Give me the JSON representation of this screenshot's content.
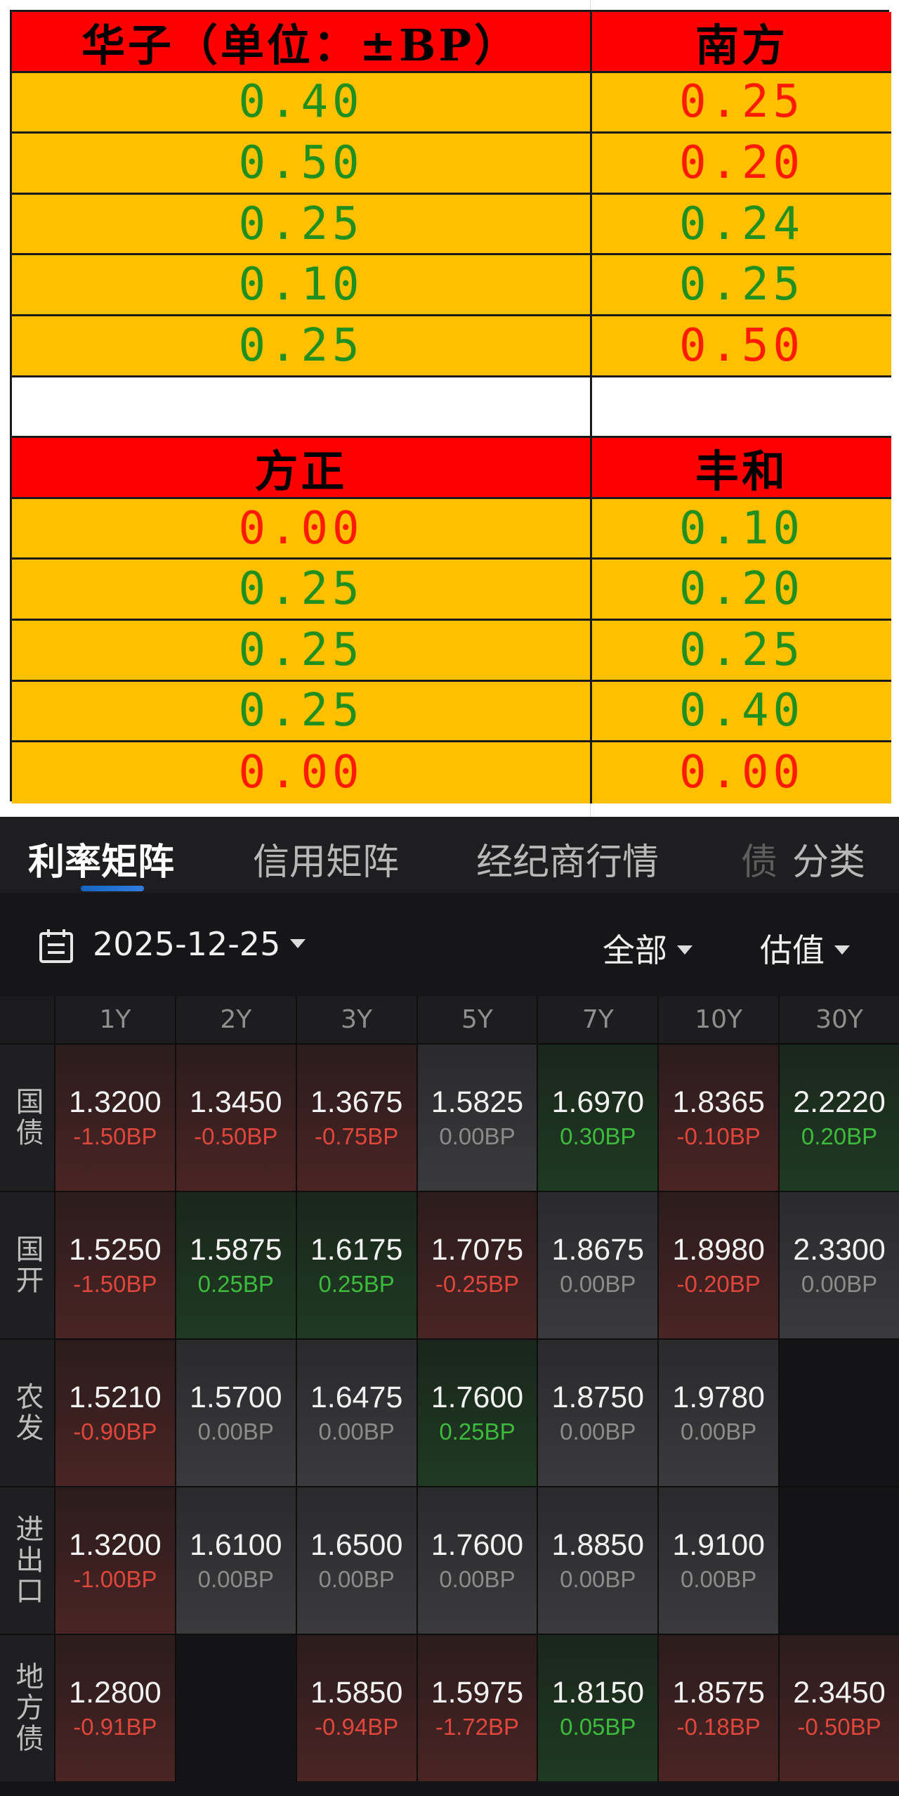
{
  "sheet": {
    "block1": {
      "headers": [
        "华子（单位：±BP）",
        "南方"
      ],
      "rows": [
        {
          "left": "0.40",
          "left_color": "green",
          "right": "0.25",
          "right_color": "red"
        },
        {
          "left": "0.50",
          "left_color": "green",
          "right": "0.20",
          "right_color": "red"
        },
        {
          "left": "0.25",
          "left_color": "green",
          "right": "0.24",
          "right_color": "green"
        },
        {
          "left": "0.10",
          "left_color": "green",
          "right": "0.25",
          "right_color": "green"
        },
        {
          "left": "0.25",
          "left_color": "green",
          "right": "0.50",
          "right_color": "red"
        }
      ]
    },
    "block2": {
      "headers": [
        "方正",
        "丰和"
      ],
      "rows": [
        {
          "left": "0.00",
          "left_color": "red",
          "right": "0.10",
          "right_color": "green"
        },
        {
          "left": "0.25",
          "left_color": "green",
          "right": "0.20",
          "right_color": "green"
        },
        {
          "left": "0.25",
          "left_color": "green",
          "right": "0.25",
          "right_color": "green"
        },
        {
          "left": "0.25",
          "left_color": "green",
          "right": "0.40",
          "right_color": "green"
        },
        {
          "left": "0.00",
          "left_color": "red",
          "right": "0.00",
          "right_color": "red"
        }
      ]
    },
    "colors": {
      "header_bg": "#ff0000",
      "cell_bg": "#ffc000",
      "green_text": "#1f8f1f",
      "red_text": "#ff1a00"
    }
  },
  "tabs": [
    {
      "label": "利率矩阵",
      "active": true
    },
    {
      "label": "信用矩阵",
      "active": false
    },
    {
      "label": "经纪商行情",
      "active": false
    },
    {
      "label": "债",
      "active": false
    },
    {
      "label": "分类",
      "active": false
    }
  ],
  "filters": {
    "date": "2025-12-25",
    "scope": "全部",
    "mode": "估值",
    "calendar_icon": "calendar-icon"
  },
  "matrix": {
    "columns": [
      "1Y",
      "2Y",
      "3Y",
      "5Y",
      "7Y",
      "10Y",
      "30Y"
    ],
    "rows": [
      {
        "label": "国债",
        "cells": [
          {
            "rate": "1.3200",
            "chg": "-1.50BP",
            "dir": "red"
          },
          {
            "rate": "1.3450",
            "chg": "-0.50BP",
            "dir": "red"
          },
          {
            "rate": "1.3675",
            "chg": "-0.75BP",
            "dir": "red"
          },
          {
            "rate": "1.5825",
            "chg": "0.00BP",
            "dir": "flat"
          },
          {
            "rate": "1.6970",
            "chg": "0.30BP",
            "dir": "green"
          },
          {
            "rate": "1.8365",
            "chg": "-0.10BP",
            "dir": "red"
          },
          {
            "rate": "2.2220",
            "chg": "0.20BP",
            "dir": "green"
          }
        ]
      },
      {
        "label": "国开",
        "cells": [
          {
            "rate": "1.5250",
            "chg": "-1.50BP",
            "dir": "red"
          },
          {
            "rate": "1.5875",
            "chg": "0.25BP",
            "dir": "green"
          },
          {
            "rate": "1.6175",
            "chg": "0.25BP",
            "dir": "green"
          },
          {
            "rate": "1.7075",
            "chg": "-0.25BP",
            "dir": "red"
          },
          {
            "rate": "1.8675",
            "chg": "0.00BP",
            "dir": "flat"
          },
          {
            "rate": "1.8980",
            "chg": "-0.20BP",
            "dir": "red"
          },
          {
            "rate": "2.3300",
            "chg": "0.00BP",
            "dir": "flat"
          }
        ]
      },
      {
        "label": "农发",
        "cells": [
          {
            "rate": "1.5210",
            "chg": "-0.90BP",
            "dir": "red"
          },
          {
            "rate": "1.5700",
            "chg": "0.00BP",
            "dir": "flat"
          },
          {
            "rate": "1.6475",
            "chg": "0.00BP",
            "dir": "flat"
          },
          {
            "rate": "1.7600",
            "chg": "0.25BP",
            "dir": "green"
          },
          {
            "rate": "1.8750",
            "chg": "0.00BP",
            "dir": "flat"
          },
          {
            "rate": "1.9780",
            "chg": "0.00BP",
            "dir": "flat"
          },
          null
        ]
      },
      {
        "label": "进出口",
        "cells": [
          {
            "rate": "1.3200",
            "chg": "-1.00BP",
            "dir": "red"
          },
          {
            "rate": "1.6100",
            "chg": "0.00BP",
            "dir": "flat"
          },
          {
            "rate": "1.6500",
            "chg": "0.00BP",
            "dir": "flat"
          },
          {
            "rate": "1.7600",
            "chg": "0.00BP",
            "dir": "flat"
          },
          {
            "rate": "1.8850",
            "chg": "0.00BP",
            "dir": "flat"
          },
          {
            "rate": "1.9100",
            "chg": "0.00BP",
            "dir": "flat"
          },
          null
        ]
      },
      {
        "label": "地方债",
        "cells": [
          {
            "rate": "1.2800",
            "chg": "-0.91BP",
            "dir": "red"
          },
          null,
          {
            "rate": "1.5850",
            "chg": "-0.94BP",
            "dir": "red"
          },
          {
            "rate": "1.5975",
            "chg": "-1.72BP",
            "dir": "red"
          },
          {
            "rate": "1.8150",
            "chg": "0.05BP",
            "dir": "green"
          },
          {
            "rate": "1.8575",
            "chg": "-0.18BP",
            "dir": "red"
          },
          {
            "rate": "2.3450",
            "chg": "-0.50BP",
            "dir": "red"
          }
        ]
      }
    ]
  }
}
